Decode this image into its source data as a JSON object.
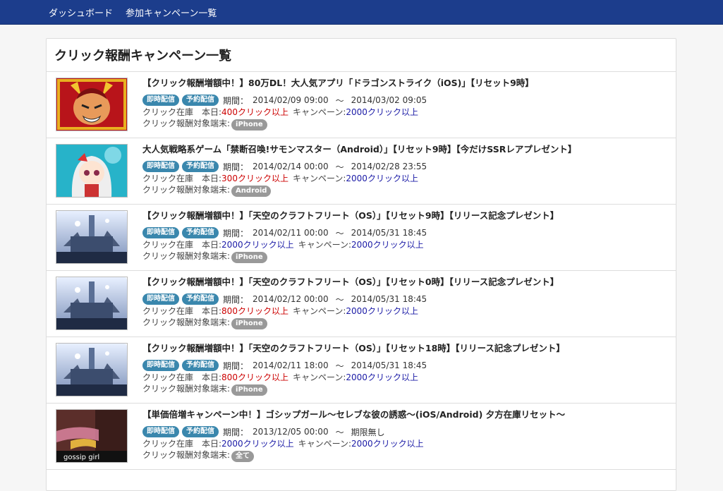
{
  "nav": {
    "items": [
      {
        "label": "ダッシュボード"
      },
      {
        "label": "参加キャンペーン一覧"
      }
    ]
  },
  "panel": {
    "title": "クリック報酬キャンペーン一覧",
    "labels": {
      "badge_instant": "即時配信",
      "badge_scheduled": "予約配信",
      "period": "期間：",
      "tilde": "〜",
      "stock": "クリック在庫　本日:",
      "campaign": "キャンペーン:",
      "device": "クリック報酬対象端末:"
    },
    "rows": [
      {
        "title": "【クリック報酬増額中！】80万DL！大人気アプリ「ドラゴンストライク（iOS)」【リセット9時】",
        "start": "2014/02/09 09:00",
        "end": "2014/03/02 09:05",
        "today": "400クリック以上",
        "today_color": "#cc0000",
        "campaign": "2000クリック以上",
        "device": "iPhone",
        "thumb": "dragon"
      },
      {
        "title": "大人気戦略系ゲーム「禁断召喚!サモンマスター（Android）」【リセット9時】【今だけSSRレアプレゼント】",
        "start": "2014/02/14 00:00",
        "end": "2014/02/28 23:55",
        "today": "300クリック以上",
        "today_color": "#cc0000",
        "campaign": "2000クリック以上",
        "device": "Android",
        "thumb": "summon"
      },
      {
        "title": "【クリック報酬増額中！】「天空のクラフトフリート（OS）」【リセット9時】【リリース記念プレゼント】",
        "start": "2014/02/11 00:00",
        "end": "2014/05/31 18:45",
        "today": "2000クリック以上",
        "today_color": "#1a1aa6",
        "campaign": "2000クリック以上",
        "device": "iPhone",
        "thumb": "fleet"
      },
      {
        "title": "【クリック報酬増額中！】「天空のクラフトフリート（OS）」【リセット0時】【リリース記念プレゼント】",
        "start": "2014/02/12 00:00",
        "end": "2014/05/31 18:45",
        "today": "800クリック以上",
        "today_color": "#cc0000",
        "campaign": "2000クリック以上",
        "device": "iPhone",
        "thumb": "fleet"
      },
      {
        "title": "【クリック報酬増額中！】「天空のクラフトフリート（OS）」【リセット18時】【リリース記念プレゼント】",
        "start": "2014/02/11 18:00",
        "end": "2014/05/31 18:45",
        "today": "800クリック以上",
        "today_color": "#cc0000",
        "campaign": "2000クリック以上",
        "device": "iPhone",
        "thumb": "fleet"
      },
      {
        "title": "【単価倍増キャンペーン中！】ゴシップガール〜セレブな彼の誘惑〜(iOS/Android) 夕方在庫リセット〜",
        "start": "2013/12/05 00:00",
        "end": "期限無し",
        "today": "2000クリック以上",
        "today_color": "#1a1aa6",
        "campaign": "2000クリック以上",
        "device": "全て",
        "thumb": "gossip",
        "thumb_text": "gossip girl"
      }
    ]
  }
}
